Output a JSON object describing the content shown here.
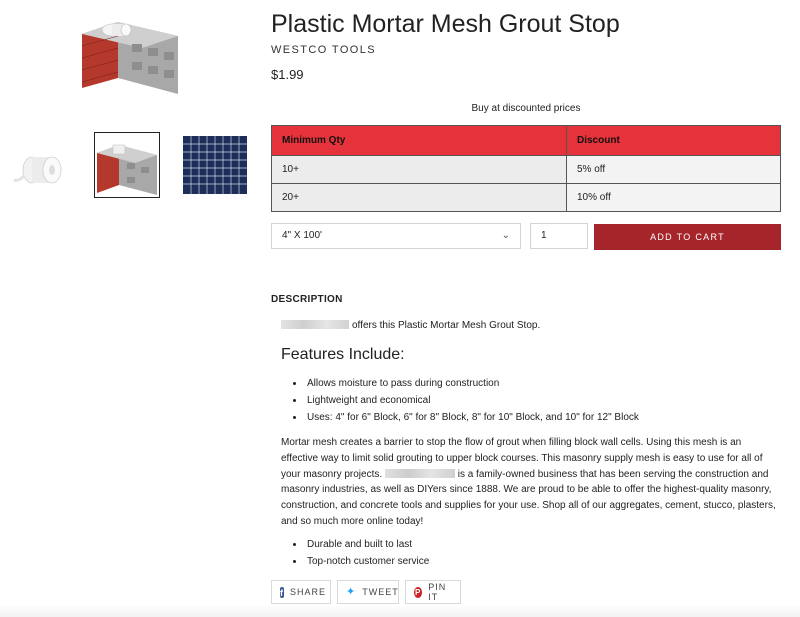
{
  "product": {
    "title": "Plastic Mortar Mesh Grout Stop",
    "vendor": "WESTCO TOOLS",
    "price": "$1.99"
  },
  "discounts": {
    "caption": "Buy at discounted prices",
    "headers": [
      "Minimum Qty",
      "Discount"
    ],
    "rows": [
      [
        "10+",
        "5% off"
      ],
      [
        "20+",
        "10% off"
      ]
    ],
    "header_color": "#e5323b"
  },
  "cart": {
    "variant": "4\" X 100'",
    "quantity": "1",
    "add_to_cart": "ADD TO CART",
    "button_color": "#a5252b"
  },
  "description": {
    "heading": "DESCRIPTION",
    "intro": "offers this Plastic Mortar Mesh Grout Stop.",
    "features_heading": "Features Include:",
    "features": [
      "Allows moisture to pass during construction",
      "Lightweight and economical",
      "Uses: 4\" for 6\" Block, 6\" for 8\" Block, 8\" for 10\" Block, and 10\" for 12\" Block"
    ],
    "paragraph_before": "Mortar mesh creates a barrier to stop the flow of grout when filling block wall cells. Using this mesh is an effective way to limit solid grouting to upper block courses. This masonry supply mesh is easy to use for all of your masonry projects.",
    "paragraph_after": "is a family-owned business that has been serving the construction and masonry industries, as well as DIYers since 1888. We are proud to be able to offer the highest-quality masonry, construction, and concrete tools and supplies for your use. Shop all of our aggregates, cement, stucco, plasters, and so much more online today!",
    "extras": [
      "Durable and built to last",
      "Top-notch customer service"
    ]
  },
  "social": {
    "share": "SHARE",
    "tweet": "TWEET",
    "pin": "PIN IT"
  }
}
